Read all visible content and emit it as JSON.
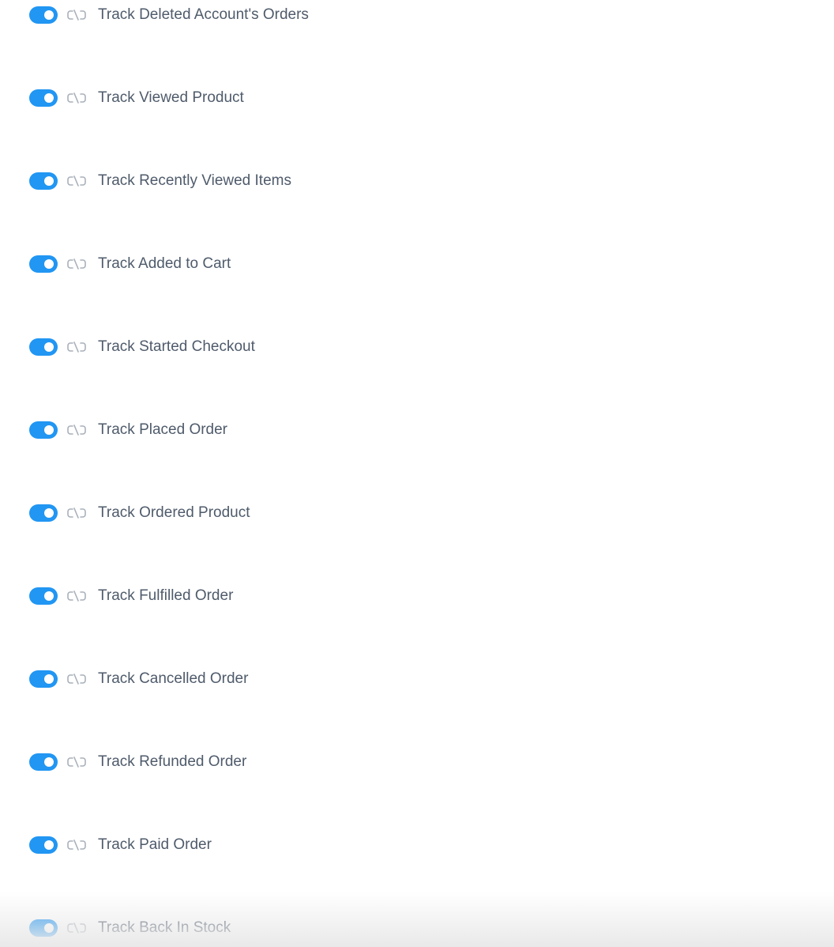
{
  "accent_color": "#2196f3",
  "settings": [
    {
      "label": "Track Deleted Account's Orders",
      "enabled": true,
      "icon": "unlink-icon"
    },
    {
      "label": "Track Viewed Product",
      "enabled": true,
      "icon": "unlink-icon"
    },
    {
      "label": "Track Recently Viewed Items",
      "enabled": true,
      "icon": "unlink-icon"
    },
    {
      "label": "Track Added to Cart",
      "enabled": true,
      "icon": "unlink-icon"
    },
    {
      "label": "Track Started Checkout",
      "enabled": true,
      "icon": "unlink-icon"
    },
    {
      "label": "Track Placed Order",
      "enabled": true,
      "icon": "unlink-icon"
    },
    {
      "label": "Track Ordered Product",
      "enabled": true,
      "icon": "unlink-icon"
    },
    {
      "label": "Track Fulfilled Order",
      "enabled": true,
      "icon": "unlink-icon"
    },
    {
      "label": "Track Cancelled Order",
      "enabled": true,
      "icon": "unlink-icon"
    },
    {
      "label": "Track Refunded Order",
      "enabled": true,
      "icon": "unlink-icon"
    },
    {
      "label": "Track Paid Order",
      "enabled": true,
      "icon": "unlink-icon"
    },
    {
      "label": "Track Back In Stock",
      "enabled": true,
      "icon": "unlink-icon"
    }
  ]
}
